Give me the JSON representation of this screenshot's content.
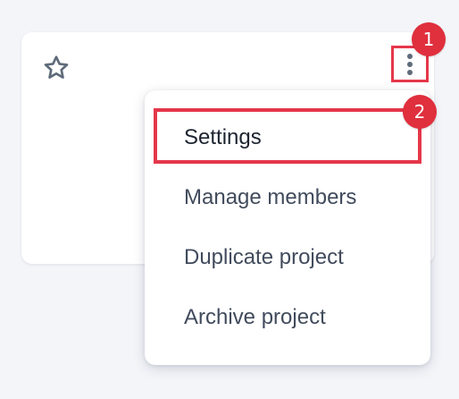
{
  "card": {
    "star_icon": "star-outline-icon",
    "more_icon": "kebab-vertical-icon"
  },
  "annotations": {
    "step1": "1",
    "step2": "2"
  },
  "menu": {
    "items": [
      {
        "label": "Settings"
      },
      {
        "label": "Manage members"
      },
      {
        "label": "Duplicate project"
      },
      {
        "label": "Archive project"
      }
    ]
  },
  "colors": {
    "highlight": "#e5374a",
    "badge": "#e02f3d",
    "background": "#f3f5f9",
    "icon": "#5f6b7a"
  }
}
